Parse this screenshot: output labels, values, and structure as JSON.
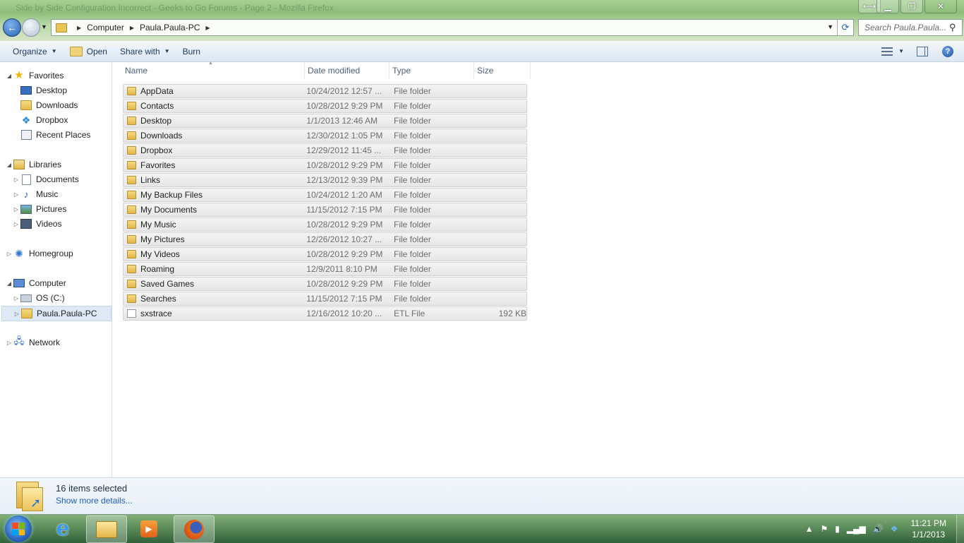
{
  "window": {
    "background_title": "Side by Side Configuration Incorrect - Geeks to Go Forums - Page 2 - Mozilla Firefox"
  },
  "address_bar": {
    "crumbs": [
      "Computer",
      "Paula.Paula-PC"
    ]
  },
  "search": {
    "placeholder": "Search Paula.Paula..."
  },
  "toolbar": {
    "organize": "Organize",
    "open": "Open",
    "share_with": "Share with",
    "burn": "Burn"
  },
  "nav": {
    "favorites": "Favorites",
    "fav_items": [
      "Desktop",
      "Downloads",
      "Dropbox",
      "Recent Places"
    ],
    "libraries": "Libraries",
    "lib_items": [
      "Documents",
      "Music",
      "Pictures",
      "Videos"
    ],
    "homegroup": "Homegroup",
    "computer": "Computer",
    "comp_items": [
      "OS (C:)",
      "Paula.Paula-PC"
    ],
    "network": "Network"
  },
  "columns": {
    "name": "Name",
    "date": "Date modified",
    "type": "Type",
    "size": "Size"
  },
  "files": [
    {
      "name": "AppData",
      "date": "10/24/2012 12:57 ...",
      "type": "File folder",
      "size": "",
      "icon": "folder-icon"
    },
    {
      "name": "Contacts",
      "date": "10/28/2012 9:29 PM",
      "type": "File folder",
      "size": "",
      "icon": "contacts-folder-icon"
    },
    {
      "name": "Desktop",
      "date": "1/1/2013 12:46 AM",
      "type": "File folder",
      "size": "",
      "icon": "desktop-folder-icon"
    },
    {
      "name": "Downloads",
      "date": "12/30/2012 1:05 PM",
      "type": "File folder",
      "size": "",
      "icon": "downloads-folder-icon"
    },
    {
      "name": "Dropbox",
      "date": "12/29/2012 11:45 ...",
      "type": "File folder",
      "size": "",
      "icon": "dropbox-folder-icon"
    },
    {
      "name": "Favorites",
      "date": "10/28/2012 9:29 PM",
      "type": "File folder",
      "size": "",
      "icon": "favorites-folder-icon"
    },
    {
      "name": "Links",
      "date": "12/13/2012 9:39 PM",
      "type": "File folder",
      "size": "",
      "icon": "links-folder-icon"
    },
    {
      "name": "My Backup Files",
      "date": "10/24/2012 1:20 AM",
      "type": "File folder",
      "size": "",
      "icon": "folder-icon"
    },
    {
      "name": "My Documents",
      "date": "11/15/2012 7:15 PM",
      "type": "File folder",
      "size": "",
      "icon": "documents-folder-icon"
    },
    {
      "name": "My Music",
      "date": "10/28/2012 9:29 PM",
      "type": "File folder",
      "size": "",
      "icon": "music-folder-icon"
    },
    {
      "name": "My Pictures",
      "date": "12/26/2012 10:27 ...",
      "type": "File folder",
      "size": "",
      "icon": "pictures-folder-icon"
    },
    {
      "name": "My Videos",
      "date": "10/28/2012 9:29 PM",
      "type": "File folder",
      "size": "",
      "icon": "videos-folder-icon"
    },
    {
      "name": "Roaming",
      "date": "12/9/2011 8:10 PM",
      "type": "File folder",
      "size": "",
      "icon": "folder-icon"
    },
    {
      "name": "Saved Games",
      "date": "10/28/2012 9:29 PM",
      "type": "File folder",
      "size": "",
      "icon": "saved-games-folder-icon"
    },
    {
      "name": "Searches",
      "date": "11/15/2012 7:15 PM",
      "type": "File folder",
      "size": "",
      "icon": "searches-folder-icon"
    },
    {
      "name": "sxstrace",
      "date": "12/16/2012 10:20 ...",
      "type": "ETL File",
      "size": "192 KB",
      "icon": "file-icon"
    }
  ],
  "details": {
    "count": "16 items selected",
    "more": "Show more details..."
  },
  "taskbar": {
    "time": "11:21 PM",
    "date": "1/1/2013"
  }
}
